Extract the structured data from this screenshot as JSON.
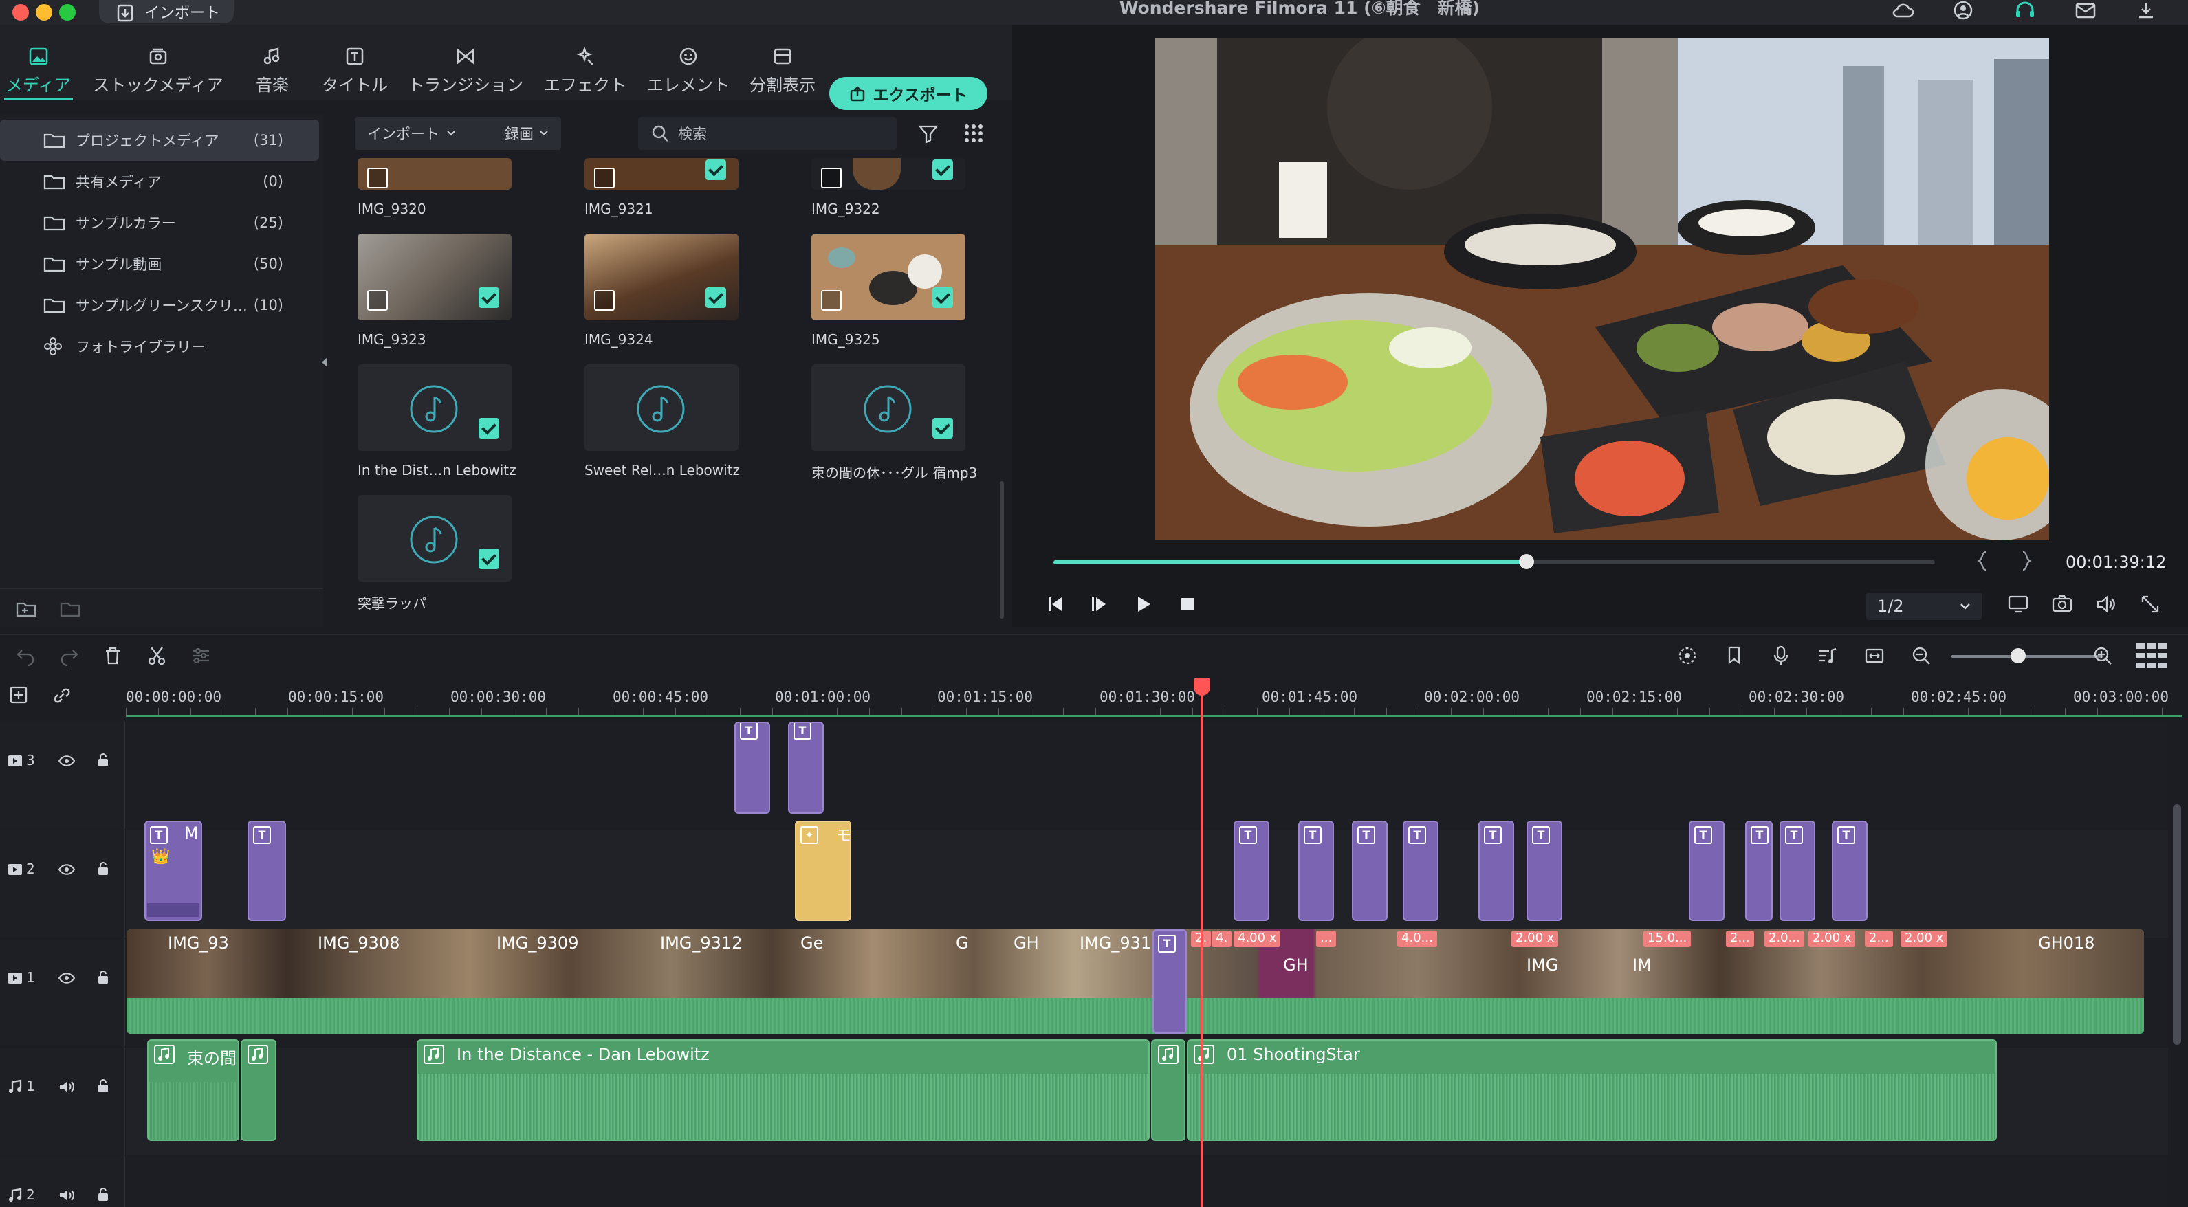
{
  "window": {
    "title": "Wondershare Filmora 11 (⑥朝食　新橋)",
    "import_button": "インポート"
  },
  "tabs": [
    {
      "id": "media",
      "label": "メディア",
      "icon": "image-icon",
      "active": true
    },
    {
      "id": "stock",
      "label": "ストックメディア",
      "icon": "photo-stack-icon",
      "active": false
    },
    {
      "id": "music",
      "label": "音楽",
      "icon": "music-note-icon",
      "active": false
    },
    {
      "id": "title",
      "label": "タイトル",
      "icon": "text-t-icon",
      "active": false
    },
    {
      "id": "transition",
      "label": "トランジション",
      "icon": "transition-icon",
      "active": false
    },
    {
      "id": "effect",
      "label": "エフェクト",
      "icon": "sparkle-wand-icon",
      "active": false
    },
    {
      "id": "element",
      "label": "エレメント",
      "icon": "smiley-icon",
      "active": false
    },
    {
      "id": "split",
      "label": "分割表示",
      "icon": "split-screen-icon",
      "active": false
    }
  ],
  "export_button": "エクスポート",
  "sidebar": {
    "items": [
      {
        "label": "プロジェクトメディア",
        "count": "(31)",
        "selected": true,
        "icon": "folder-icon"
      },
      {
        "label": "共有メディア",
        "count": "(0)",
        "selected": false,
        "icon": "folder-icon"
      },
      {
        "label": "サンプルカラー",
        "count": "(25)",
        "selected": false,
        "icon": "folder-icon"
      },
      {
        "label": "サンプル動画",
        "count": "(50)",
        "selected": false,
        "icon": "folder-icon"
      },
      {
        "label": "サンプルグリーンスクリ…",
        "count": "(10)",
        "selected": false,
        "icon": "folder-icon"
      },
      {
        "label": "フォトライブラリー",
        "count": "",
        "selected": false,
        "icon": "flower-icon"
      }
    ]
  },
  "media_toolbar": {
    "import_dropdown": "インポート",
    "record_dropdown": "録画",
    "search_placeholder": "検索"
  },
  "media_items": [
    {
      "name": "IMG_9320",
      "kind": "video",
      "checked": false,
      "thumb": "#6b4b32"
    },
    {
      "name": "IMG_9321",
      "kind": "video",
      "checked": true,
      "thumb": "#5b3a24"
    },
    {
      "name": "IMG_9322",
      "kind": "video",
      "checked": true,
      "thumb": "#6a4a30"
    },
    {
      "name": "IMG_9323",
      "kind": "video",
      "checked": true,
      "thumb": "#8a8784"
    },
    {
      "name": "IMG_9324",
      "kind": "video",
      "checked": true,
      "thumb": "#6e5238"
    },
    {
      "name": "IMG_9325",
      "kind": "video",
      "checked": true,
      "thumb": "#9a7a5a"
    },
    {
      "name": "In the Dist…n Lebowitz",
      "kind": "audio",
      "checked": true
    },
    {
      "name": "Sweet Rel…n Lebowitz",
      "kind": "audio",
      "checked": false
    },
    {
      "name": "束の間の休･･･グル 宿mp3",
      "kind": "audio",
      "checked": true
    },
    {
      "name": "突撃ラッパ",
      "kind": "audio",
      "checked": true
    }
  ],
  "player": {
    "timecode": "00:01:39:12",
    "progress_fraction": 0.537,
    "zoom": "1/2"
  },
  "ruler_labels": [
    "00:00:00:00",
    "00:00:15:00",
    "00:00:30:00",
    "00:00:45:00",
    "00:01:00:00",
    "00:01:15:00",
    "00:01:30:00",
    "00:01:45:00",
    "00:02:00:00",
    "00:02:15:00",
    "00:02:30:00",
    "00:02:45:00",
    "00:03:00:00"
  ],
  "tracks": {
    "v3": "3",
    "v2": "2",
    "v1": "1",
    "a1": "1",
    "a2": "2"
  },
  "track2_title_text": "M",
  "track2_effect_text": "モ",
  "video_clips": [
    {
      "name": "IMG_93"
    },
    {
      "name": "IMG_9308"
    },
    {
      "name": "IMG_9309"
    },
    {
      "name": "IMG_9312"
    },
    {
      "name": "Ge"
    },
    {
      "name": "G"
    },
    {
      "name": "GH"
    },
    {
      "name": "IMG_931"
    },
    {
      "name": "GH"
    },
    {
      "name": "IMG"
    },
    {
      "name": "IM"
    },
    {
      "name": "GH018"
    }
  ],
  "speed_badges": [
    "2.",
    "4.",
    "4.00 x",
    "...",
    "4.0...",
    "2.00 x",
    "15.0...",
    "2...",
    "2.0...",
    "2.00 x",
    "2...",
    "2.00 x"
  ],
  "audio_clips": [
    {
      "name": "束の間"
    },
    {
      "name": "In the Distance - Dan Lebowitz"
    },
    {
      "name": "01 ShootingStar"
    }
  ]
}
